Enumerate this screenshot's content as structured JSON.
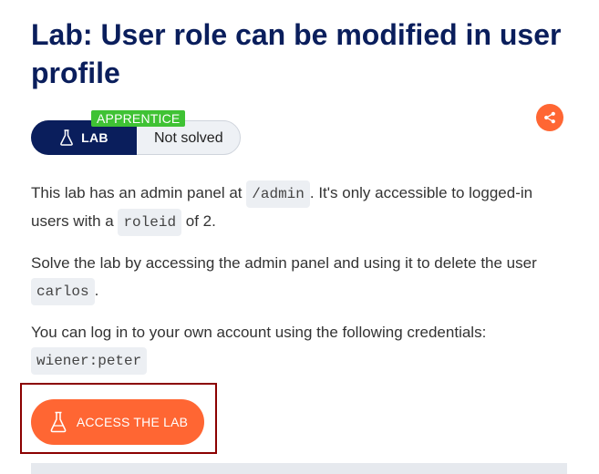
{
  "header": {
    "title": "Lab: User role can be modified in user profile"
  },
  "status": {
    "level_badge": "APPRENTICE",
    "lab_label": "LAB",
    "state": "Not solved"
  },
  "icons": {
    "flask": "flask-icon",
    "share": "share-icon"
  },
  "description": {
    "p1_part1": "This lab has an admin panel at ",
    "p1_code1": "/admin",
    "p1_part2": ". It's only accessible to logged-in users with a ",
    "p1_code2": "roleid",
    "p1_part3": " of 2.",
    "p2_part1": "Solve the lab by accessing the admin panel and using it to delete the user ",
    "p2_code": "carlos",
    "p2_part2": ".",
    "p3_part1": "You can log in to your own account using the following credentials: ",
    "p3_code": "wiener:peter"
  },
  "actions": {
    "access_label": "ACCESS THE LAB"
  },
  "colors": {
    "title": "#0a1e5c",
    "accent": "#ff6633",
    "badge": "#3fc234",
    "highlight_frame": "#8b0000"
  }
}
